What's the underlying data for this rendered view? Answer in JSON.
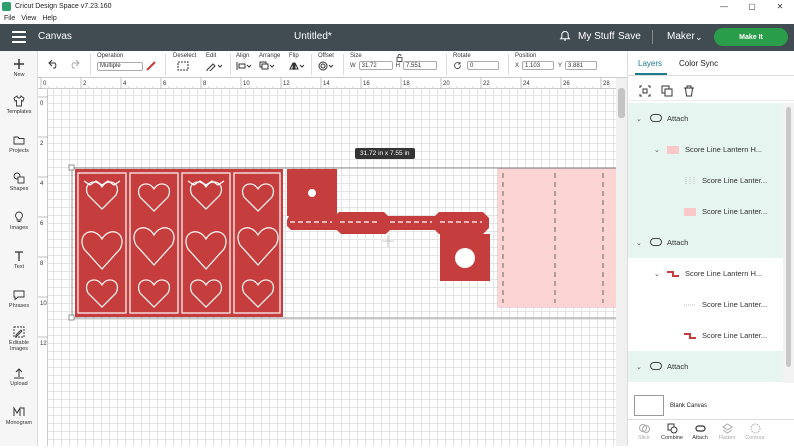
{
  "window": {
    "title": "Cricut Design Space  v7.23.160",
    "controls": [
      "—",
      "▢",
      "✕"
    ]
  },
  "menu": [
    "File",
    "View",
    "Help"
  ],
  "header": {
    "canvas_label": "Canvas",
    "doc_title": "Untitled*",
    "my_stuff": "My Stuff",
    "save": "Save",
    "machine": "Maker",
    "make_it": "Make It"
  },
  "toolbar": {
    "operation_label": "Operation",
    "operation_value": "Multiple",
    "deselect_label": "Deselect",
    "edit_label": "Edit",
    "align_label": "Align",
    "arrange_label": "Arrange",
    "flip_label": "Flip",
    "offset_label": "Offset",
    "size_label": "Size",
    "size_w_label": "W",
    "size_w": "31.72",
    "size_h_label": "H",
    "size_h": "7.551",
    "rotate_label": "Rotate",
    "rotate_value": "0",
    "position_label": "Position",
    "pos_x_label": "X",
    "pos_x": "1.103",
    "pos_y_label": "Y",
    "pos_y": "3.881"
  },
  "left_nav": [
    {
      "label": "New",
      "icon": "plus-icon"
    },
    {
      "label": "Templates",
      "icon": "shirt-icon"
    },
    {
      "label": "Projects",
      "icon": "folder-icon"
    },
    {
      "label": "Shapes",
      "icon": "shapes-icon"
    },
    {
      "label": "Images",
      "icon": "lightbulb-icon"
    },
    {
      "label": "Text",
      "icon": "text-icon"
    },
    {
      "label": "Phrases",
      "icon": "speech-bubble-icon"
    },
    {
      "label": "Editable Images",
      "icon": "editable-image-icon"
    },
    {
      "label": "Upload",
      "icon": "upload-icon"
    },
    {
      "label": "Monogram",
      "icon": "monogram-icon"
    }
  ],
  "ruler": {
    "top": [
      "0",
      "2",
      "4",
      "6",
      "8",
      "10",
      "12",
      "14",
      "16",
      "18",
      "20",
      "22",
      "24",
      "26",
      "28"
    ],
    "left": [
      "0",
      "2",
      "4",
      "6",
      "8",
      "10",
      "12"
    ]
  },
  "canvas": {
    "dimension_tooltip": "31.72  in x 7.55  in"
  },
  "right_panel": {
    "tabs": [
      "Layers",
      "Color Sync"
    ],
    "active_tab": "Layers",
    "layers": [
      {
        "type": "group",
        "label": "Attach"
      },
      {
        "type": "sub",
        "label": "Score Line Lantern H...",
        "swatch": "#f9c9c9"
      },
      {
        "type": "item",
        "label": "Score Line Lanter...",
        "swatch": "score"
      },
      {
        "type": "item",
        "label": "Score Line Lanter...",
        "swatch": "#f9c9c9"
      },
      {
        "type": "group",
        "label": "Attach"
      },
      {
        "type": "sub",
        "label": "Score Line Lantern H...",
        "swatch": "#c63d3d"
      },
      {
        "type": "item",
        "label": "Score Line Lanter...",
        "swatch": "score"
      },
      {
        "type": "item",
        "label": "Score Line Lanter...",
        "swatch": "#c63d3d"
      },
      {
        "type": "group",
        "label": "Attach"
      }
    ],
    "blank_canvas": "Blank Canvas",
    "bottom_actions": [
      {
        "label": "Slice",
        "enabled": false
      },
      {
        "label": "Combine",
        "enabled": true
      },
      {
        "label": "Attach",
        "enabled": true
      },
      {
        "label": "Flatten",
        "enabled": false
      },
      {
        "label": "Contour",
        "enabled": false
      }
    ]
  },
  "colors": {
    "header_bg": "#414b52",
    "make_it_green": "#2a9d4b",
    "accent_teal": "#1f7a8c",
    "lantern_red": "#c63d3d",
    "lantern_pink": "#fdd4d4",
    "group_row_bg": "#e6f5ef"
  }
}
